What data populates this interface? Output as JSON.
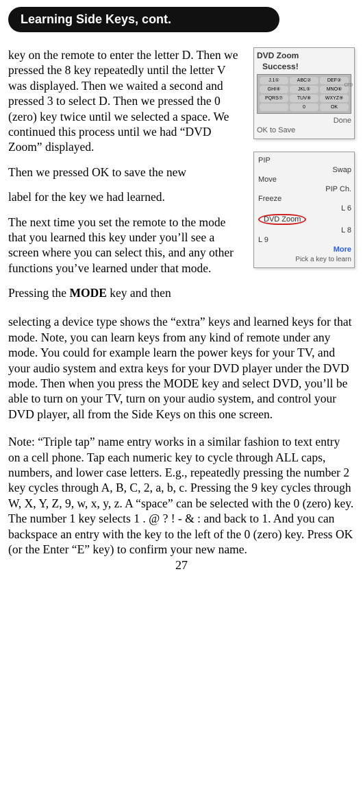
{
  "header": {
    "title": "Learning Side Keys, cont."
  },
  "text": {
    "p1": "key on the remote to enter the letter D. Then we pressed the 8 key repeatedly until the letter V was displayed. Then we waited a second and pressed 3 to select D. Then we pressed the 0 (zero) key twice until we selected a space. We continued this process until we had “DVD Zoom” displayed.",
    "p2": "Then we pressed OK to save the new",
    "p3": "label for the key we had learned.",
    "p4": "The next time you set the remote to the mode that you learned this key under you’ll see a screen where you can select this, and any other functions you’ve learned under that mode.",
    "p5a": "Pressing the ",
    "p5_bold": "MODE",
    "p5b": " key and then",
    "p6": "selecting a device type shows the “extra” keys and learned keys for that mode. Note, you can learn keys from any kind of remote under any mode. You could for example learn the power keys for your TV, and your audio system and extra keys for your DVD player under the DVD mode. Then when you press the MODE key and select DVD, you’ll be able to turn on your TV, turn on your audio system, and control your DVD player, all from the Side Keys on this one screen.",
    "p7": "Note: “Triple tap” name entry works in a similar fashion to text entry on a cell phone. Tap each numeric key to cycle through ALL caps, numbers, and lower case letters. E.g., repeatedly pressing the number 2 key cycles through A, B, C, 2, a, b, c. Pressing the 9 key cycles through W, X, Y, Z, 9, w, x, y, z. A “space” can be selected with the 0 (zero) key. The number 1 key selects 1 . @ ? ! - & : and back to 1. And you can backspace an entry with the key to the left of the 0 (zero) key. Press OK (or the Enter “E” key) to confirm your new name."
  },
  "fig1": {
    "title": "DVD Zoom",
    "success": "Success!",
    "cropped": "cro",
    "cells": [
      "J.1①",
      "ABC②",
      "DEF③",
      "GHI④",
      "JKL⑤",
      "MNO⑥",
      "PQRS⑦",
      "TUV⑧",
      "WXYZ⑨",
      "",
      "0",
      "OK"
    ],
    "done": "Done",
    "oksave": "OK to Save"
  },
  "fig2": {
    "rows": [
      {
        "l": "PIP",
        "r": ""
      },
      {
        "l": "",
        "r": "Swap"
      },
      {
        "l": "Move",
        "r": ""
      },
      {
        "l": "",
        "r": "PIP Ch."
      },
      {
        "l": "Freeze",
        "r": ""
      },
      {
        "l": "",
        "r": "L 6"
      },
      {
        "l": "DVD Zoom",
        "r": "",
        "circled": true
      },
      {
        "l": "",
        "r": "L 8"
      },
      {
        "l": "L 9",
        "r": ""
      },
      {
        "l": "",
        "r": "More"
      }
    ],
    "footer": "Pick a key to learn"
  },
  "page_number": "27"
}
